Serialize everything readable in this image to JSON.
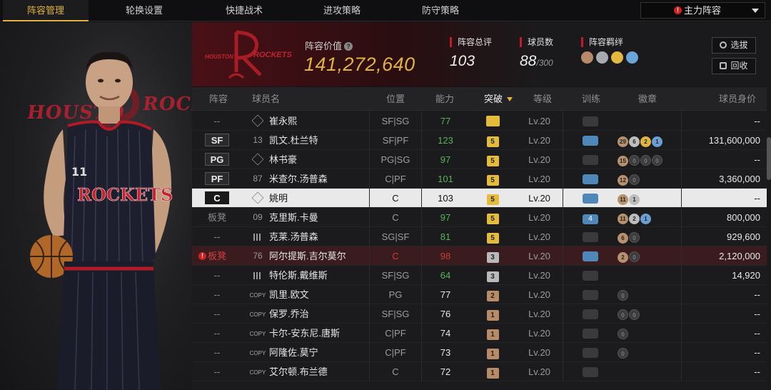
{
  "tabs": [
    {
      "label": "阵容管理",
      "active": true
    },
    {
      "label": "轮换设置",
      "active": false
    },
    {
      "label": "快捷战术",
      "active": false
    },
    {
      "label": "进攻策略",
      "active": false
    },
    {
      "label": "防守策略",
      "active": false
    }
  ],
  "lineup_select": {
    "value": "主力阵容",
    "warning": "!"
  },
  "portrait": {
    "team_word_left": "HOUSTO",
    "team_word_right": "ROCK"
  },
  "header": {
    "logo_text": "ROCKETS",
    "logo_city": "HOUSTON",
    "value_label": "阵容价值",
    "value": "141,272,640",
    "team_rating_label": "阵容总评",
    "team_rating": "103",
    "players_label": "球员数",
    "players": "88",
    "players_max": "/300",
    "bond_label": "阵容羁绊",
    "select_btn": "选拔",
    "recycle_btn": "回收"
  },
  "columns": {
    "pos": "阵容",
    "name": "球员名",
    "position": "位置",
    "ovr": "能力",
    "breakthrough": "突破",
    "level": "等级",
    "training": "训练",
    "badges": "徽章",
    "salary": "球员身价"
  },
  "colors": {
    "accent": "#e0b33c",
    "red": "#c21c2a",
    "green": "#58b458"
  },
  "rows": [
    {
      "pos": "--",
      "num": "",
      "num_kind": "star",
      "name": "崔永熙",
      "position": "SF|SG",
      "ovr": "77",
      "ovr_color": "green",
      "brk": "",
      "brk_kind": "crown",
      "lv": "Lv.20",
      "train": "",
      "train_kind": "empty",
      "badges": [],
      "salary": "--"
    },
    {
      "pos": "SF",
      "num": "13",
      "num_kind": "num",
      "name": "凯文.杜兰特",
      "position": "SF|PF",
      "ovr": "123",
      "ovr_color": "green",
      "brk": "5",
      "brk_kind": "gold",
      "lv": "Lv.20",
      "train": "",
      "train_kind": "blue",
      "badges": [
        {
          "t": "bz",
          "v": "29"
        },
        {
          "t": "sv",
          "v": "6"
        },
        {
          "t": "gd",
          "v": "2"
        },
        {
          "t": "hf",
          "v": "1"
        }
      ],
      "salary": "131,600,000"
    },
    {
      "pos": "PG",
      "num": "",
      "num_kind": "star",
      "name": "林书豪",
      "position": "PG|SG",
      "ovr": "97",
      "ovr_color": "green",
      "brk": "5",
      "brk_kind": "gold",
      "lv": "Lv.20",
      "train": "",
      "train_kind": "empty",
      "badges": [
        {
          "t": "bz",
          "v": "15"
        },
        {
          "t": "em",
          "v": "0"
        },
        {
          "t": "em",
          "v": "0"
        },
        {
          "t": "em",
          "v": "0"
        }
      ],
      "salary": "--"
    },
    {
      "pos": "PF",
      "num": "87",
      "num_kind": "num",
      "name": "米查尔.汤普森",
      "position": "C|PF",
      "ovr": "101",
      "ovr_color": "green",
      "brk": "5",
      "brk_kind": "gold",
      "lv": "Lv.20",
      "train": "",
      "train_kind": "blue",
      "badges": [
        {
          "t": "bz",
          "v": "12"
        },
        {
          "t": "em",
          "v": "0"
        }
      ],
      "salary": "3,360,000"
    },
    {
      "pos": "C",
      "num": "",
      "num_kind": "star",
      "name": "姚明",
      "position": "C",
      "ovr": "103",
      "ovr_color": "white",
      "brk": "5",
      "brk_kind": "gold",
      "lv": "Lv.20",
      "train": "",
      "train_kind": "blue",
      "badges": [
        {
          "t": "bz",
          "v": "11"
        },
        {
          "t": "sv",
          "v": "1"
        }
      ],
      "salary": "--",
      "selected": true
    },
    {
      "pos": "板凳",
      "num": "09",
      "num_kind": "num",
      "name": "克里斯.卡曼",
      "position": "C",
      "ovr": "97",
      "ovr_color": "green",
      "brk": "5",
      "brk_kind": "gold",
      "lv": "Lv.20",
      "train": "4",
      "train_kind": "blue",
      "badges": [
        {
          "t": "bz",
          "v": "11"
        },
        {
          "t": "sv",
          "v": "2"
        },
        {
          "t": "hf",
          "v": "1"
        }
      ],
      "salary": "800,000"
    },
    {
      "pos": "--",
      "num": "",
      "num_kind": "bars",
      "name": "克莱.汤普森",
      "position": "SG|SF",
      "ovr": "81",
      "ovr_color": "green",
      "brk": "5",
      "brk_kind": "gold",
      "lv": "Lv.20",
      "train": "",
      "train_kind": "empty",
      "badges": [
        {
          "t": "bz",
          "v": "6"
        },
        {
          "t": "em",
          "v": "0"
        }
      ],
      "salary": "929,600"
    },
    {
      "pos": "板凳",
      "num": "76",
      "num_kind": "num",
      "name": "阿尔提斯.吉尔莫尔",
      "position": "C",
      "ovr": "98",
      "ovr_color": "green",
      "brk": "3",
      "brk_kind": "silver",
      "lv": "Lv.20",
      "train": "",
      "train_kind": "blue",
      "badges": [
        {
          "t": "bz",
          "v": "2"
        },
        {
          "t": "em",
          "v": "0"
        }
      ],
      "salary": "2,120,000",
      "warn": true
    },
    {
      "pos": "--",
      "num": "",
      "num_kind": "bars",
      "name": "特伦斯.戴维斯",
      "position": "SF|SG",
      "ovr": "64",
      "ovr_color": "green",
      "brk": "3",
      "brk_kind": "silver",
      "lv": "Lv.20",
      "train": "",
      "train_kind": "empty",
      "badges": [],
      "salary": "14,920"
    },
    {
      "pos": "--",
      "num": "COPY",
      "num_kind": "copy",
      "name": "凯里.欧文",
      "position": "PG",
      "ovr": "77",
      "ovr_color": "white",
      "brk": "2",
      "brk_kind": "bronze",
      "lv": "Lv.20",
      "train": "",
      "train_kind": "empty",
      "badges": [
        {
          "t": "em",
          "v": "0"
        }
      ],
      "salary": "--"
    },
    {
      "pos": "--",
      "num": "COPY",
      "num_kind": "copy",
      "name": "保罗.乔治",
      "position": "SF|SG",
      "ovr": "76",
      "ovr_color": "white",
      "brk": "1",
      "brk_kind": "bronze",
      "lv": "Lv.20",
      "train": "",
      "train_kind": "empty",
      "badges": [
        {
          "t": "em",
          "v": "0"
        },
        {
          "t": "em",
          "v": "0"
        }
      ],
      "salary": "--"
    },
    {
      "pos": "--",
      "num": "COPY",
      "num_kind": "copy",
      "name": "卡尔-安东尼.唐斯",
      "position": "C|PF",
      "ovr": "74",
      "ovr_color": "white",
      "brk": "1",
      "brk_kind": "bronze",
      "lv": "Lv.20",
      "train": "",
      "train_kind": "empty",
      "badges": [
        {
          "t": "em",
          "v": "0"
        }
      ],
      "salary": "--"
    },
    {
      "pos": "--",
      "num": "COPY",
      "num_kind": "copy",
      "name": "阿隆佐.莫宁",
      "position": "C|PF",
      "ovr": "73",
      "ovr_color": "white",
      "brk": "1",
      "brk_kind": "bronze",
      "lv": "Lv.20",
      "train": "",
      "train_kind": "empty",
      "badges": [
        {
          "t": "em",
          "v": "0"
        }
      ],
      "salary": "--"
    },
    {
      "pos": "--",
      "num": "COPY",
      "num_kind": "copy",
      "name": "艾尔顿.布兰德",
      "position": "C",
      "ovr": "72",
      "ovr_color": "white",
      "brk": "1",
      "brk_kind": "bronze",
      "lv": "Lv.20",
      "train": "",
      "train_kind": "empty",
      "badges": [],
      "salary": "--"
    }
  ]
}
